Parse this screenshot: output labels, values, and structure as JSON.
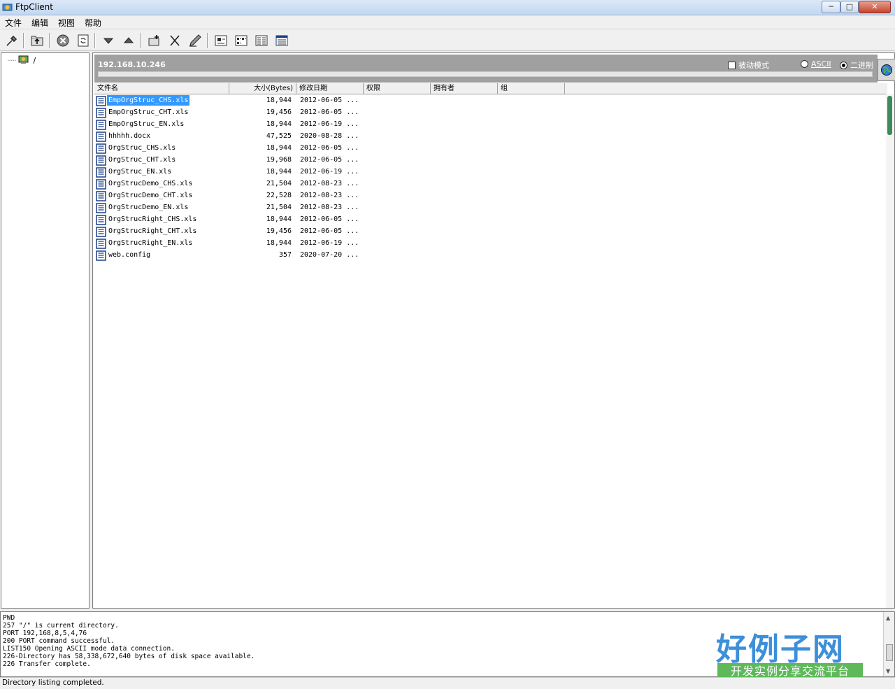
{
  "window": {
    "title": "FtpClient",
    "minimize": "─",
    "maximize": "□",
    "close": "✕"
  },
  "menu": [
    "文件",
    "编辑",
    "视图",
    "帮助"
  ],
  "toolbar": [
    {
      "name": "connect-button",
      "icon": "plug-icon"
    },
    {
      "name": "parent-dir-button",
      "icon": "folder-up-icon"
    },
    {
      "name": "stop-button",
      "icon": "stop-icon"
    },
    {
      "name": "refresh-button",
      "icon": "refresh-icon"
    },
    {
      "name": "download-button",
      "icon": "arrow-down-icon"
    },
    {
      "name": "upload-button",
      "icon": "arrow-up-icon"
    },
    {
      "name": "new-folder-button",
      "icon": "new-folder-icon"
    },
    {
      "name": "delete-button",
      "icon": "delete-icon"
    },
    {
      "name": "rename-button",
      "icon": "pen-icon"
    },
    {
      "name": "view-large-icons-button",
      "icon": "large-icons-icon"
    },
    {
      "name": "view-small-icons-button",
      "icon": "small-icons-icon"
    },
    {
      "name": "view-list-button",
      "icon": "list-view-icon"
    },
    {
      "name": "view-details-button",
      "icon": "details-view-icon"
    }
  ],
  "tree": {
    "root_label": "/"
  },
  "host": {
    "address": "192.168.10.246",
    "passive_label": "被动模式",
    "ascii_label": "ASCII",
    "binary_label": "二进制"
  },
  "columns": [
    "文件名",
    "大小(Bytes)",
    "修改日期",
    "权限",
    "拥有者",
    "组"
  ],
  "files": [
    {
      "name": "EmpOrgStruc_CHS.xls",
      "size": "18,944",
      "date": "2012-06-05 ..."
    },
    {
      "name": "EmpOrgStruc_CHT.xls",
      "size": "19,456",
      "date": "2012-06-05 ..."
    },
    {
      "name": "EmpOrgStruc_EN.xls",
      "size": "18,944",
      "date": "2012-06-19 ..."
    },
    {
      "name": "hhhhh.docx",
      "size": "47,525",
      "date": "2020-08-28 ..."
    },
    {
      "name": "OrgStruc_CHS.xls",
      "size": "18,944",
      "date": "2012-06-05 ..."
    },
    {
      "name": "OrgStruc_CHT.xls",
      "size": "19,968",
      "date": "2012-06-05 ..."
    },
    {
      "name": "OrgStruc_EN.xls",
      "size": "18,944",
      "date": "2012-06-19 ..."
    },
    {
      "name": "OrgStrucDemo_CHS.xls",
      "size": "21,504",
      "date": "2012-08-23 ..."
    },
    {
      "name": "OrgStrucDemo_CHT.xls",
      "size": "22,528",
      "date": "2012-08-23 ..."
    },
    {
      "name": "OrgStrucDemo_EN.xls",
      "size": "21,504",
      "date": "2012-08-23 ..."
    },
    {
      "name": "OrgStrucRight_CHS.xls",
      "size": "18,944",
      "date": "2012-06-05 ..."
    },
    {
      "name": "OrgStrucRight_CHT.xls",
      "size": "19,456",
      "date": "2012-06-05 ..."
    },
    {
      "name": "OrgStrucRight_EN.xls",
      "size": "18,944",
      "date": "2012-06-19 ..."
    },
    {
      "name": "web.config",
      "size": "357",
      "date": "2020-07-20 ..."
    }
  ],
  "log": [
    "PWD",
    "257 \"/\" is current directory.",
    "PORT 192,168,8,5,4,76",
    "200 PORT command successful.",
    "LIST150 Opening ASCII mode data connection.",
    "226-Directory has 58,338,672,640 bytes of disk space available.",
    "226 Transfer complete."
  ],
  "status": "Directory listing completed.",
  "watermark": {
    "title": "好例子网",
    "subtitle": "开发实例分享交流平台"
  }
}
